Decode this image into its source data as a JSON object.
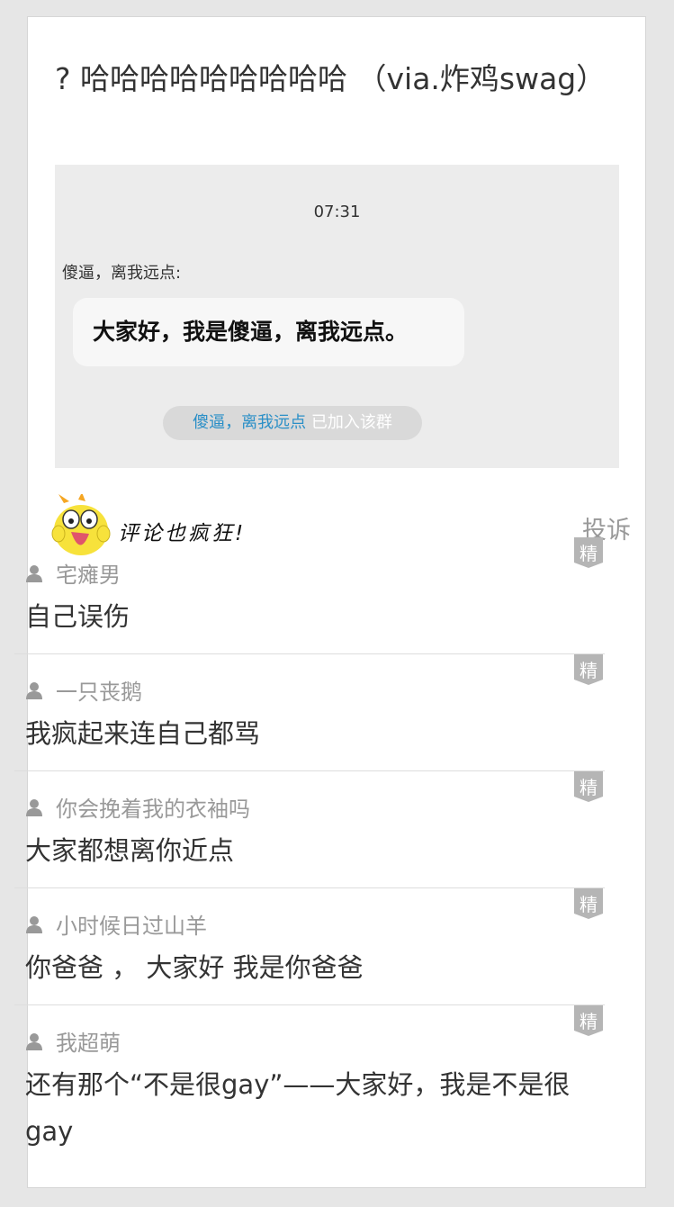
{
  "post": {
    "title": "? 哈哈哈哈哈哈哈哈哈 （via.炸鸡swag）"
  },
  "screenshot": {
    "time": "07:31",
    "sender": "傻逼，离我远点:",
    "message": "大家好，我是傻逼，离我远点。",
    "notice_name": "傻逼，离我远点",
    "notice_suffix": " 已加入该群"
  },
  "section": {
    "title": "评论也疯狂!",
    "report_label": "投诉"
  },
  "badge_label": "精",
  "comments": [
    {
      "user": "宅瘫男",
      "text": "自己误伤"
    },
    {
      "user": "一只丧鹅",
      "text": "我疯起来连自己都骂"
    },
    {
      "user": "你会挽着我的衣袖吗",
      "text": "大家都想离你近点"
    },
    {
      "user": "小时候日过山羊",
      "text": "你爸爸 ， 大家好 我是你爸爸"
    },
    {
      "user": "我超萌",
      "text": "还有那个“不是很gay”——大家好，我是不是很gay"
    }
  ],
  "colors": {
    "background": "#e6e6e6",
    "card": "#ffffff",
    "muted_text": "#999999",
    "body_text": "#333333",
    "badge": "#b5b5b5",
    "link_blue": "#2a8fc7"
  }
}
